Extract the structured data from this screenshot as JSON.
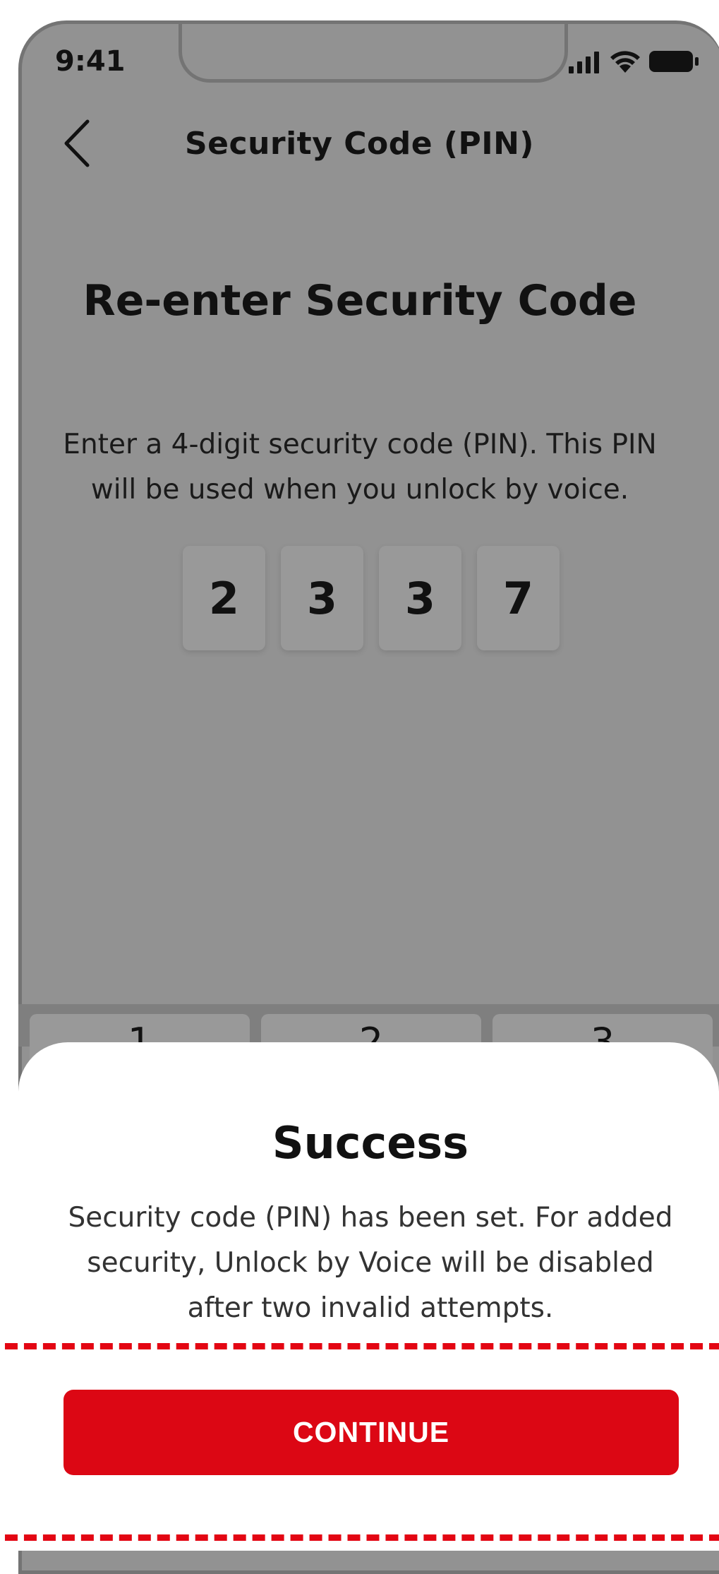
{
  "status_bar": {
    "time": "9:41"
  },
  "header": {
    "title": "Security Code (PIN)"
  },
  "main": {
    "heading": "Re-enter Security Code",
    "description": "Enter a 4-digit security code (PIN). This PIN will be used when you unlock by voice.",
    "pin_digits": [
      "2",
      "3",
      "3",
      "7"
    ]
  },
  "keypad": {
    "keys": [
      "1",
      "2",
      "3"
    ]
  },
  "dialog": {
    "title": "Success",
    "message": "Security code (PIN) has been set. For added security, Unlock by Voice will be disabled after two invalid attempts.",
    "continue_label": "CONTINUE"
  },
  "colors": {
    "accent": "#dc0714",
    "highlight": "#e30613",
    "overlay": "#929292"
  }
}
